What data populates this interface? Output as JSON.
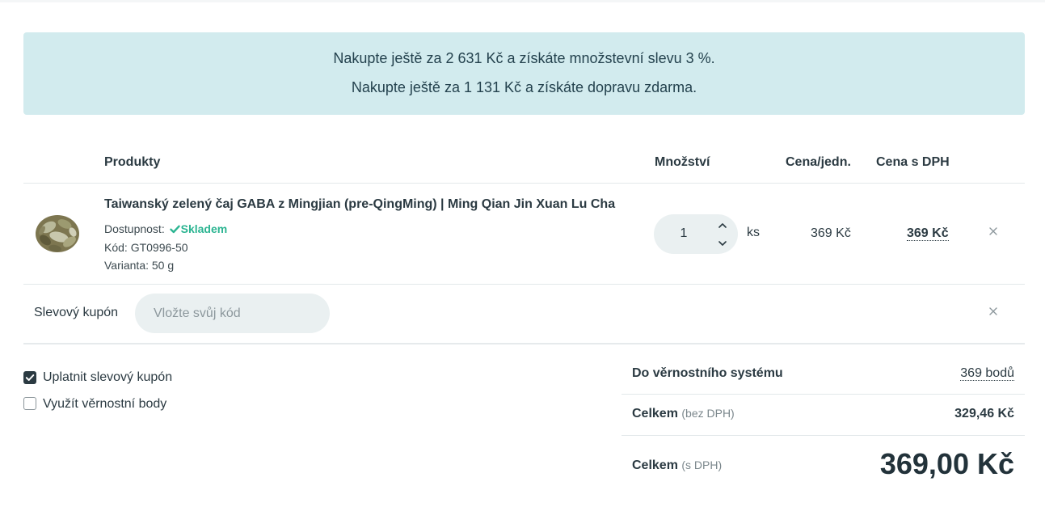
{
  "banner": {
    "line1": "Nakupte ještě za 2 631 Kč a získáte množstevní slevu 3 %.",
    "line2": "Nakupte ještě za 1 131 Kč a získáte dopravu zdarma."
  },
  "table": {
    "headers": {
      "products": "Produkty",
      "quantity": "Množství",
      "unit_price": "Cena/jedn.",
      "total": "Cena s DPH"
    },
    "rows": [
      {
        "name": "Taiwanský zelený čaj GABA z Mingjian (pre-QingMing) | Ming Qian Jin Xuan Lu Cha",
        "availability_label": "Dostupnost:",
        "availability_value": "Skladem",
        "code": "Kód: GT0996-50",
        "variant": "Varianta: 50 g",
        "quantity": "1",
        "unit": "ks",
        "unit_price": "369 Kč",
        "total": "369 Kč"
      }
    ]
  },
  "coupon": {
    "label": "Slevový kupón",
    "placeholder": "Vložte svůj kód"
  },
  "options": {
    "apply_coupon": {
      "label": "Uplatnit slevový kupón",
      "checked": true
    },
    "use_points": {
      "label": "Využít věrnostní body",
      "checked": false
    }
  },
  "summary": {
    "loyalty_label": "Do věrnostního systému",
    "loyalty_value": "369 bodů",
    "total_net_label": "Celkem",
    "total_net_note": "(bez DPH)",
    "total_net_value": "329,46 Kč",
    "total_gross_label": "Celkem",
    "total_gross_note": "(s DPH)",
    "total_gross_value": "369,00 Kč"
  },
  "colors": {
    "banner_bg": "#d2ebee",
    "in_stock": "#2bb491",
    "text": "#2b3a42",
    "input_bg": "#eaf0f1"
  },
  "icons": [
    "check-icon",
    "chevron-up-icon",
    "chevron-down-icon",
    "close-icon",
    "checkbox-checked-icon",
    "checkbox-empty-icon"
  ]
}
